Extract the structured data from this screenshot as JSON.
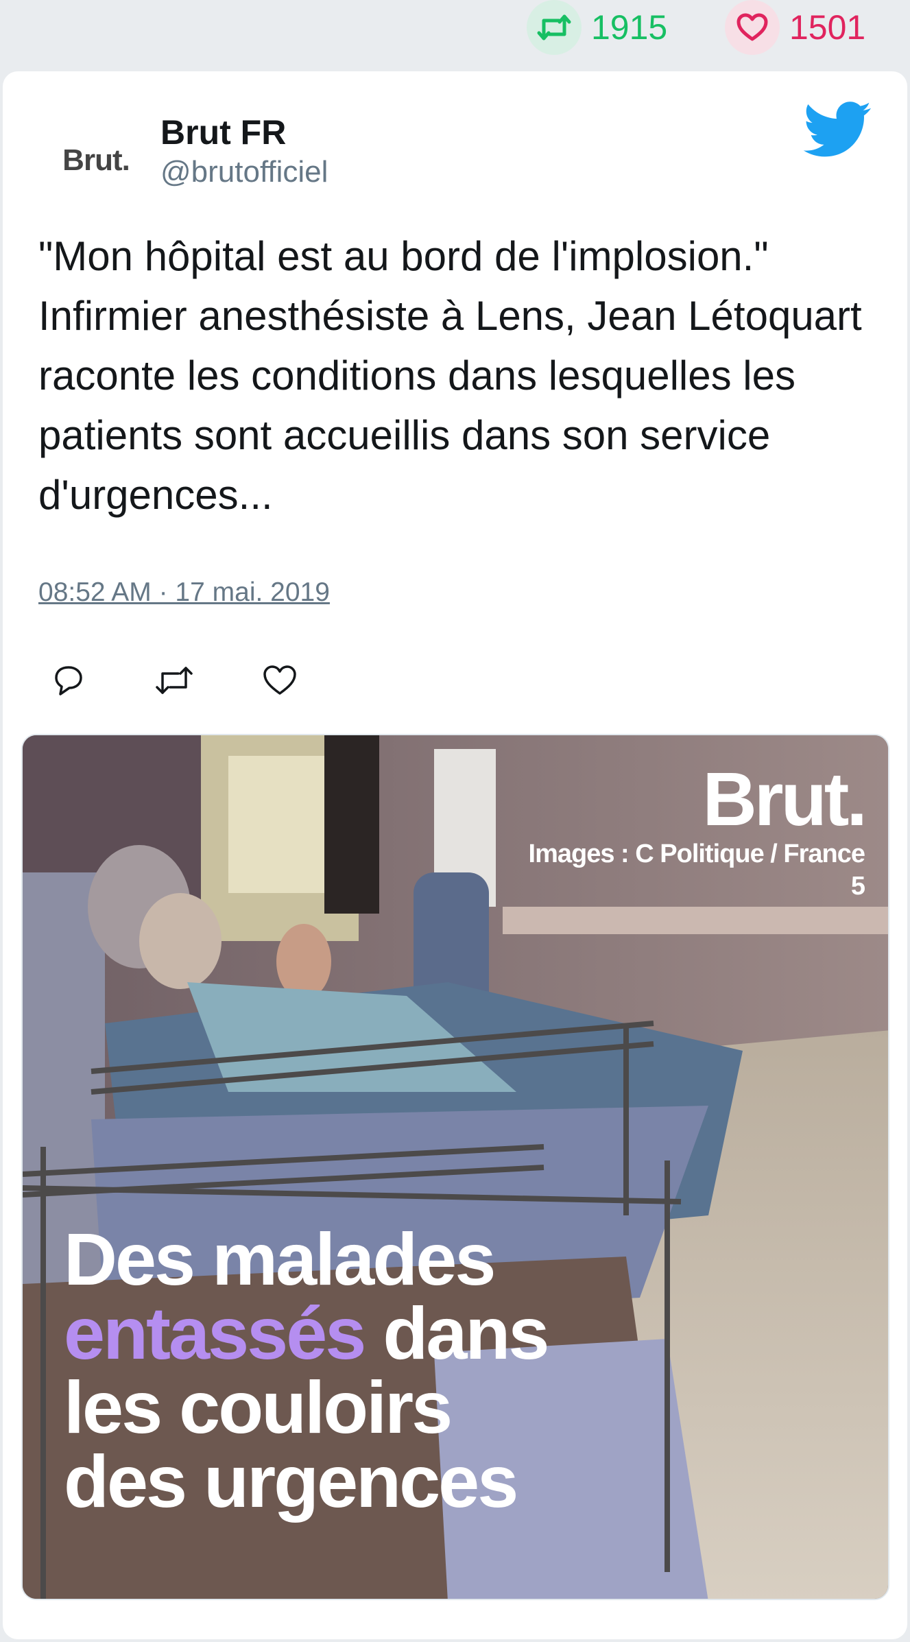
{
  "stats": {
    "retweets": "1915",
    "likes": "1501",
    "retweet_color": "#17bf63",
    "like_color": "#e0245e"
  },
  "tweet": {
    "avatar_text": "Brut.",
    "author_name": "Brut FR",
    "author_handle": "@brutofficiel",
    "text": "\"Mon hôpital est au bord de l'implosion.\" Infirmier anesthésiste à Lens, Jean Létoquart raconte les conditions dans lesquelles les patients sont accueillis dans son service d'urgences...",
    "timestamp": "08:52 AM · 17 mai. 2019"
  },
  "icons": {
    "stats": [
      "retweet-icon",
      "heart-icon"
    ],
    "brand": "twitter-bird-icon",
    "actions": [
      "reply-icon",
      "retweet-icon",
      "like-icon"
    ]
  },
  "media": {
    "watermark": "Brut.",
    "credit": "Images : C Politique / France 5",
    "caption_parts": [
      "Des malades",
      "entassés",
      "dans",
      "les couloirs",
      "des urgences"
    ],
    "highlight_color": "#b58ef0"
  }
}
